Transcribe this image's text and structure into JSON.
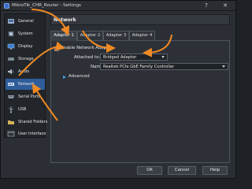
{
  "window": {
    "title": "MikroTik_CHR_Router - Settings",
    "help_glyph": "?",
    "close_glyph": "✕"
  },
  "sidebar": {
    "items": [
      {
        "label": "General",
        "icon": "general-icon"
      },
      {
        "label": "System",
        "icon": "system-icon"
      },
      {
        "label": "Display",
        "icon": "display-icon"
      },
      {
        "label": "Storage",
        "icon": "storage-icon"
      },
      {
        "label": "Audio",
        "icon": "audio-icon"
      },
      {
        "label": "Network",
        "icon": "network-icon",
        "selected": true
      },
      {
        "label": "Serial Ports",
        "icon": "serial-ports-icon"
      },
      {
        "label": "USB",
        "icon": "usb-icon"
      },
      {
        "label": "Shared Folders",
        "icon": "shared-folders-icon"
      },
      {
        "label": "User Interface",
        "icon": "user-interface-icon"
      }
    ]
  },
  "main": {
    "header": "Network",
    "tabs": [
      "Adapter 1",
      "Adapter 2",
      "Adapter 3",
      "Adapter 4"
    ],
    "active_tab": "Adapter 1",
    "enable_label": "Enable Network Adapter",
    "enable_checked": true,
    "attached_to_label": "Attached to:",
    "attached_to_value": "Bridged Adapter",
    "name_label": "Name:",
    "name_value": "Realtek PCIe GbE Family Controller",
    "advanced_label": "Advanced"
  },
  "footer": {
    "ok": "OK",
    "cancel": "Cancel",
    "help": "Help"
  },
  "colors": {
    "annotation_arrow": "#f08a24",
    "selection": "#2f5d9a",
    "accent": "#4aa3e8"
  }
}
